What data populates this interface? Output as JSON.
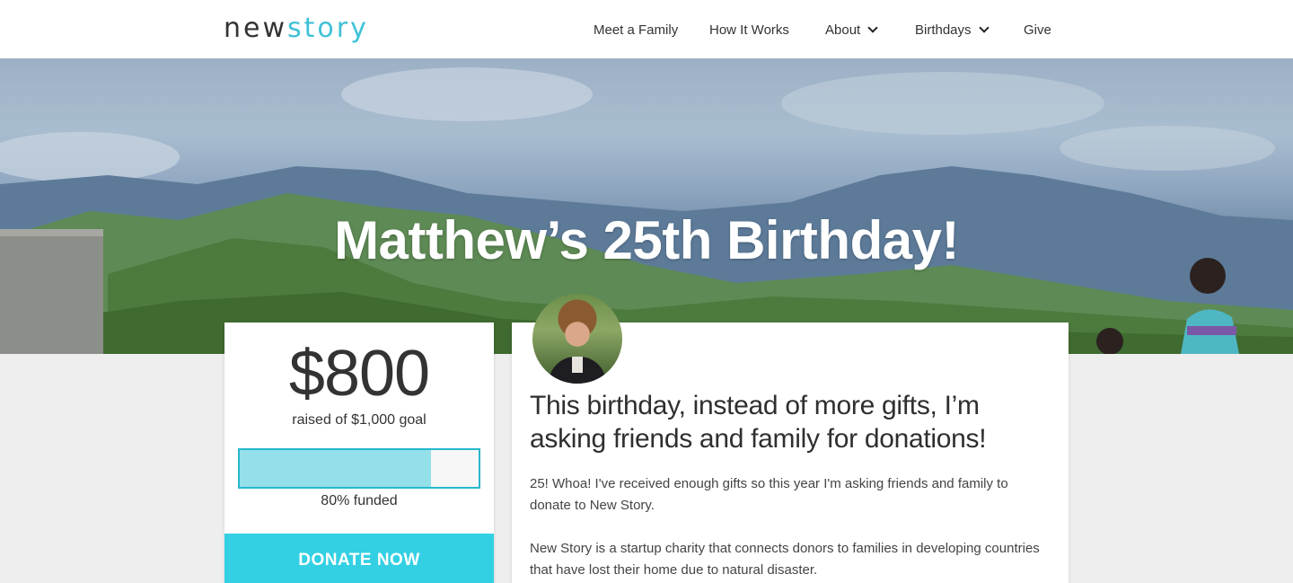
{
  "brand": {
    "logo_part1": "new",
    "logo_part2": "story",
    "accent": "#3fc1d6"
  },
  "nav": {
    "items": [
      {
        "label": "Meet a Family",
        "dropdown": false
      },
      {
        "label": "How It Works",
        "dropdown": false
      },
      {
        "label": "About",
        "dropdown": true
      },
      {
        "label": "Birthdays",
        "dropdown": true
      },
      {
        "label": "Give",
        "dropdown": false
      }
    ]
  },
  "hero": {
    "title": "Matthew’s 25th Birthday!"
  },
  "fundraiser": {
    "amount": "$800",
    "goal_text": "raised of $1,000 goal",
    "progress_fraction": 0.8,
    "funded_text": "80% funded",
    "donate_label": "DONATE NOW",
    "button_color": "#33d0e4"
  },
  "story": {
    "heading": "This birthday, instead of more gifts, I’m asking  friends and family for donations!",
    "paragraph1": "25! Whoa! I've received enough gifts so this year I'm asking friends and family to donate to New Story.",
    "paragraph2": "New Story is a startup charity that connects donors to families in developing countries that have lost their home due to natural disaster."
  }
}
